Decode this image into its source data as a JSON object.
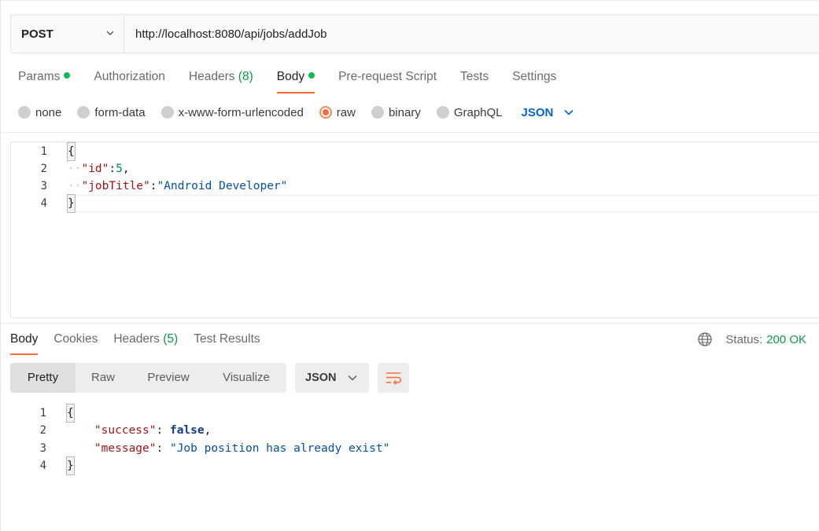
{
  "request": {
    "method": "POST",
    "url": "http://localhost:8080/api/jobs/addJob"
  },
  "request_tabs": [
    {
      "label": "Params",
      "count": "",
      "dot": true,
      "active": false
    },
    {
      "label": "Authorization",
      "count": "",
      "dot": false,
      "active": false
    },
    {
      "label": "Headers",
      "count": "(8)",
      "dot": false,
      "active": false
    },
    {
      "label": "Body",
      "count": "",
      "dot": true,
      "active": true
    },
    {
      "label": "Pre-request Script",
      "count": "",
      "dot": false,
      "active": false
    },
    {
      "label": "Tests",
      "count": "",
      "dot": false,
      "active": false
    },
    {
      "label": "Settings",
      "count": "",
      "dot": false,
      "active": false
    }
  ],
  "body_types": [
    {
      "label": "none",
      "checked": false
    },
    {
      "label": "form-data",
      "checked": false
    },
    {
      "label": "x-www-form-urlencoded",
      "checked": false
    },
    {
      "label": "raw",
      "checked": true
    },
    {
      "label": "binary",
      "checked": false
    },
    {
      "label": "GraphQL",
      "checked": false
    }
  ],
  "body_language": "JSON",
  "request_body": {
    "line_numbers": [
      "1",
      "2",
      "3",
      "4"
    ],
    "open_brace": "{",
    "close_brace": "}",
    "id_key": "\"id\"",
    "id_value": "5",
    "title_key": "\"jobTitle\"",
    "title_value": "\"Android Developer\""
  },
  "response_tabs": [
    {
      "label": "Body",
      "count": "",
      "active": true
    },
    {
      "label": "Cookies",
      "count": "",
      "active": false
    },
    {
      "label": "Headers",
      "count": "(5)",
      "active": false
    },
    {
      "label": "Test Results",
      "count": "",
      "active": false
    }
  ],
  "status": {
    "label": "Status:",
    "value": "200 OK"
  },
  "view_modes": [
    "Pretty",
    "Raw",
    "Preview",
    "Visualize"
  ],
  "response_format": "JSON",
  "response_body": {
    "line_numbers": [
      "1",
      "2",
      "3",
      "4"
    ],
    "open_brace": "{",
    "close_brace": "}",
    "success_key": "\"success\"",
    "success_value": "false",
    "message_key": "\"message\"",
    "message_value": "\"Job position has already exist\""
  },
  "colors": {
    "accent": "#ff6c37",
    "success": "#0c9c4a",
    "link": "#0265d2"
  }
}
